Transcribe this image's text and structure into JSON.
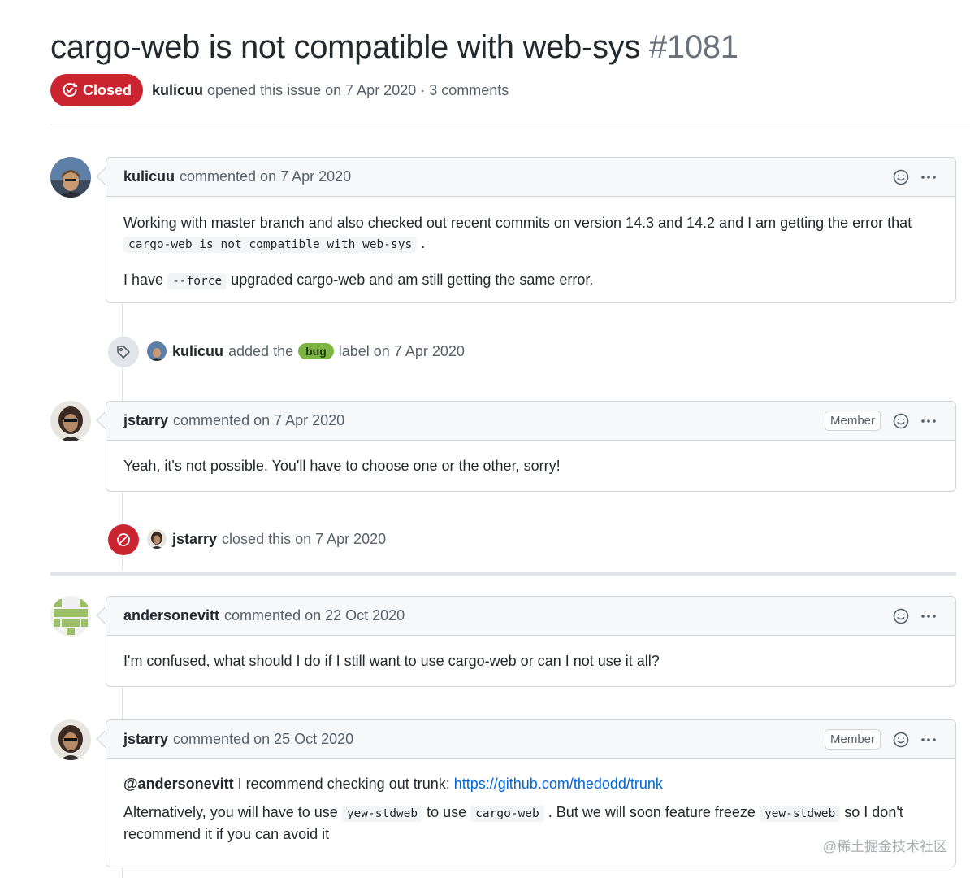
{
  "issue": {
    "title": "cargo-web is not compatible with web-sys",
    "number": "#1081",
    "state": "Closed",
    "author": "kulicuu",
    "opened_text": "opened this issue on 7 Apr 2020 · 3 comments"
  },
  "timeline": {
    "comment1": {
      "author": "kulicuu",
      "meta": "commented on 7 Apr 2020",
      "p1_text": "Working with master branch and also checked out recent commits on version 14.3 and 14.2 and I am getting the error that",
      "p1_code": "cargo-web is not compatible with web-sys",
      "p1_end": ".",
      "p2_start": "I have",
      "p2_code": "--force",
      "p2_end": "upgraded cargo-web and am still getting the same error."
    },
    "label_event": {
      "actor": "kulicuu",
      "pre": "added the",
      "label": "bug",
      "post": "label on 7 Apr 2020"
    },
    "comment2": {
      "author": "jstarry",
      "meta": "commented on 7 Apr 2020",
      "badge": "Member",
      "body": "Yeah, it's not possible. You'll have to choose one or the other, sorry!"
    },
    "close_event": {
      "actor": "jstarry",
      "text": "closed this on 7 Apr 2020"
    },
    "comment3": {
      "author": "andersonevitt",
      "meta": "commented on 22 Oct 2020",
      "body": "I'm confused, what should I do if I still want to use cargo-web or can I not use it all?"
    },
    "comment4": {
      "author": "jstarry",
      "meta": "commented on 25 Oct 2020",
      "badge": "Member",
      "mention": "@andersonevitt",
      "p1_text": "I recommend checking out trunk:",
      "link": "https://github.com/thedodd/trunk",
      "p2_a": "Alternatively, you will have to use",
      "p2_code1": "yew-stdweb",
      "p2_b": "to use",
      "p2_code2": "cargo-web",
      "p2_c": ". But we will soon feature freeze",
      "p2_code3": "yew-stdweb",
      "p2_d": "so I don't",
      "p2_e": "recommend it if you can avoid it"
    }
  },
  "watermark": "@稀土掘金技术社区",
  "icons": {
    "state": "issue-closed-icon",
    "emoji": "smiley-icon",
    "more": "kebab-horizontal-icon",
    "label_event": "tag-icon",
    "close_event": "circle-slash-icon"
  },
  "colors": {
    "closed_red": "#cb2431",
    "link_blue": "#0366d6",
    "bug_label": "#7cb342",
    "header_bg": "#f6f8fa",
    "border": "#d1d5da"
  }
}
